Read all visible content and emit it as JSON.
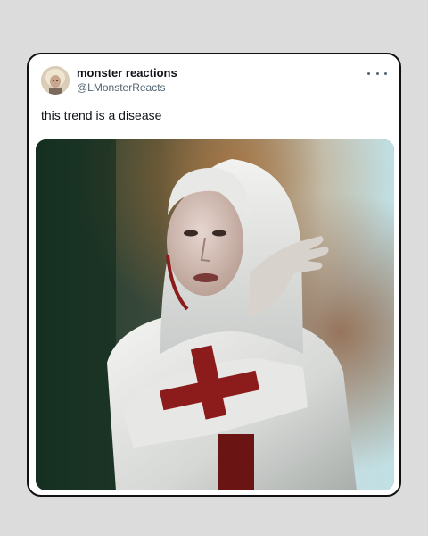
{
  "post": {
    "display_name": "monster reactions",
    "handle": "@LMonsterReacts",
    "text": "this trend is a disease",
    "menu_icon": "more-horizontal-icon",
    "avatar_icon": "profile-avatar",
    "media_icon": "attached-photo"
  },
  "colors": {
    "card_bg": "#ffffff",
    "page_bg": "#dcdcdc",
    "text_primary": "#0f1419",
    "text_secondary": "#536471",
    "accent_red": "#8c1c1c"
  }
}
